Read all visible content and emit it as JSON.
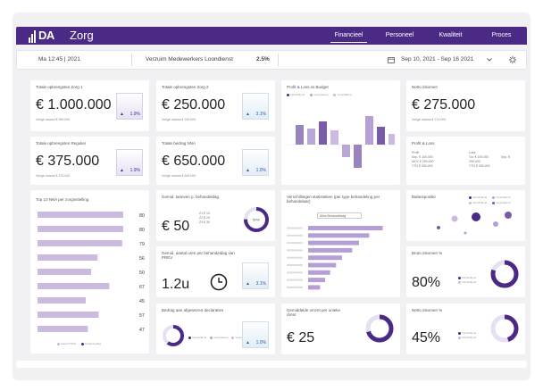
{
  "app": {
    "logo": "DA",
    "title": "Zorg"
  },
  "nav": [
    {
      "label": "Financieel",
      "active": true
    },
    {
      "label": "Personeel",
      "active": false
    },
    {
      "label": "Kwaliteit",
      "active": false
    },
    {
      "label": "Proces",
      "active": false
    }
  ],
  "subbar": {
    "date": "Ma 12:45 | 2021",
    "absence_label": "Verzuim Medewerkers Loondienst",
    "absence_value": "2.5%",
    "range": "Sep 10, 2021 - Sep 16 2021"
  },
  "kpis": {
    "opbrengsten_zorg1": {
      "title": "Totale opbrengsten Zorg 1",
      "value": "€ 1.000.000",
      "sub": "Vorige maand € 999.000",
      "delta": "1.9%"
    },
    "opbrengsten_zorg2": {
      "title": "Totale opbrengsten Zorg 2",
      "value": "€ 250.000",
      "sub": "Vorige maand € 249.000",
      "delta": "3.1%"
    },
    "opbrengsten_regulier": {
      "title": "Totale opbrengsten Regulier",
      "value": "€ 375.000",
      "sub": "Vorige maand € 374.000",
      "delta": "1.9%"
    },
    "bedrag_nna": {
      "title": "Totale bedrag NNA",
      "value": "€ 650.000",
      "sub": "Vorige maand € 649.000",
      "delta": "1.0%"
    },
    "netto_inkomen": {
      "title": "Netto inkomen",
      "value": "€ 275.000",
      "sub": "Vorige maand € 274.000"
    }
  },
  "profit_budget": {
    "title": "Profit & Loss vs Budget",
    "legend": [
      "Verschillend",
      "Verschillend",
      "Verschillend"
    ]
  },
  "profit_loss": {
    "title": "Profit & Loss",
    "col_a": "Profit",
    "col_b": "Loss",
    "rows": [
      {
        "a": "Sep. € 100.000",
        "b": "Tot. € 100.000",
        "c": "Sep. €"
      },
      {
        "a": "MOY € 250.000",
        "b": "250.000",
        "c": ""
      },
      {
        "a": "YTD € 350.000",
        "b": "YTD € 350.000",
        "c": ""
      }
    ]
  },
  "top10": {
    "title": "Top 10 NNA per zorginstelling",
    "values": [
      80,
      80,
      79,
      56,
      50,
      67,
      45,
      57,
      47
    ],
    "legend": [
      "Aantal ITWS",
      "Totaal bedrag"
    ]
  },
  "tarief": {
    "title": "Gemid. tarieven p. behandeldag",
    "value": "€ 50",
    "mini": [
      "Z1  € 10",
      "Z2  € 20",
      "Z3  € 30"
    ],
    "donut_label": "50%",
    "donut_pct": 75
  },
  "uren": {
    "title": "Gemid. aantal uren per behandeldag van PREV",
    "value": "1.2u",
    "delta": "3.1%"
  },
  "verschillingen": {
    "title": "Verschillingen statistieken (per type behandeling per behandelaar)",
    "dropdown": "Alles Behandeldag",
    "bars": [
      88,
      72,
      60,
      52,
      40,
      33,
      26,
      20,
      14
    ]
  },
  "bubbles": {
    "title": "Balanspositie",
    "legend": [
      "Verschillend",
      "Verschillend",
      "Verschillend",
      "Verschillend"
    ]
  },
  "afgewezen": {
    "title": "Bedrag aan afgewezen declaraties",
    "legend": [
      "Verschillend",
      "Verschillend",
      "Verschillend"
    ],
    "delta": "1.0%",
    "donut_pct": 60
  },
  "omzet_client": {
    "title": "Gemiddelde omzet per unieke cliënt",
    "value": "€ 25",
    "donut_pct": 70
  },
  "bruto": {
    "title": "Bruto inkomen %",
    "value": "80%",
    "donut_pct": 80,
    "legend": [
      "Verschillend",
      "Verschillend"
    ]
  },
  "netto_pct": {
    "title": "Netto inkomen %",
    "value": "45%",
    "donut_pct": 45,
    "legend": [
      "Verschillend",
      "Verschillend"
    ]
  },
  "colors": {
    "brand": "#4b2a86",
    "bar_light": "#cbbbe0",
    "bar_mid": "#b79fd6",
    "bar_dark": "#7a5ba8",
    "donut_track": "#e6e0f0"
  }
}
